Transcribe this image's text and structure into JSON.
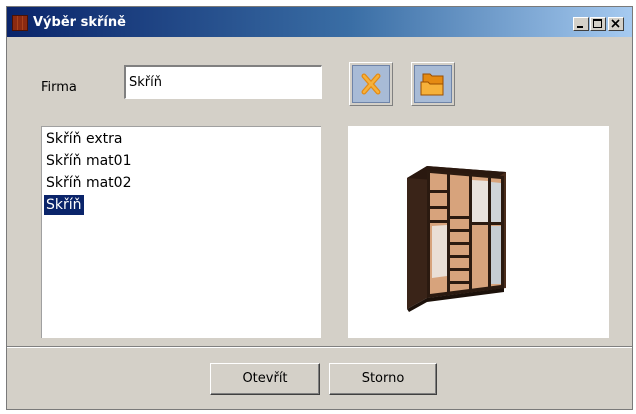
{
  "window": {
    "title": "Výběr skříně",
    "minimize_icon": "minimize-icon",
    "maximize_icon": "maximize-icon",
    "close_icon": "close-icon"
  },
  "form": {
    "firma_label": "Firma",
    "firma_value": "Skříň"
  },
  "toolbar": {
    "delete_icon": "x-icon",
    "open_icon": "folders-icon"
  },
  "list": {
    "items": [
      {
        "label": "Skříň extra",
        "selected": false
      },
      {
        "label": "Skříň mat01",
        "selected": false
      },
      {
        "label": "Skříň mat02",
        "selected": false
      },
      {
        "label": "Skříň",
        "selected": true
      }
    ]
  },
  "preview": {
    "image": "wardrobe-image"
  },
  "buttons": {
    "open_label": "Otevřít",
    "cancel_label": "Storno"
  },
  "colors": {
    "titlebar_start": "#0a246a",
    "titlebar_end": "#a6caf0",
    "selection": "#0a246a",
    "face": "#d4d0c8",
    "accent_orange": "#f39c12"
  }
}
